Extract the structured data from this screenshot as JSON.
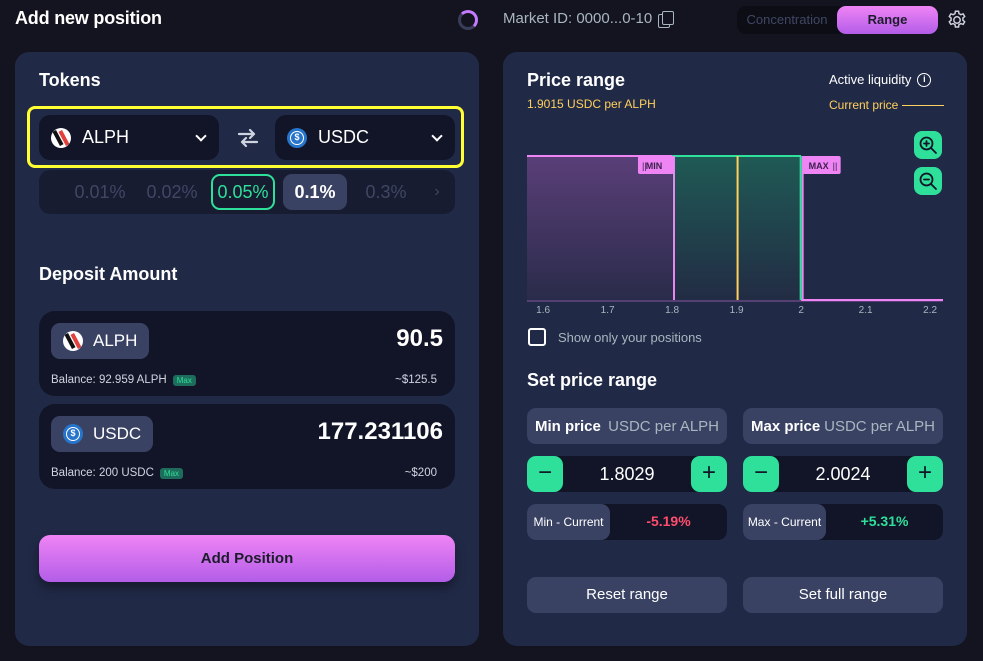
{
  "header": {
    "title": "Add new position",
    "market_id": "Market ID: 0000...0-10",
    "mode_concentration": "Concentration",
    "mode_range": "Range"
  },
  "tokens": {
    "title": "Tokens",
    "token_a": "ALPH",
    "token_b": "USDC",
    "fee_tiers": [
      "0.01%",
      "0.02%",
      "0.05%",
      "0.1%",
      "0.3%"
    ]
  },
  "deposit": {
    "title": "Deposit Amount",
    "a": {
      "token": "ALPH",
      "amount": "90.5",
      "balance": "Balance: 92.959 ALPH",
      "max": "Max",
      "usd": "~$125.5"
    },
    "b": {
      "token": "USDC",
      "amount": "177.231106",
      "balance": "Balance: 200 USDC",
      "max": "Max",
      "usd": "~$200"
    }
  },
  "add_position_label": "Add Position",
  "price_range": {
    "title": "Price range",
    "current_price_text": "1.9015 USDC per ALPH",
    "active_liquidity": "Active liquidity",
    "current_price_legend": "Current price",
    "show_only_yours": "Show only your positions"
  },
  "set_range": {
    "title": "Set price range",
    "min_label": "Min price",
    "max_label": "Max price",
    "unit": "USDC per ALPH",
    "min_value": "1.8029",
    "max_value": "2.0024",
    "min_current_label": "Min - Current",
    "min_current_value": "-5.19%",
    "max_current_label": "Max - Current",
    "max_current_value": "+5.31%",
    "reset": "Reset range",
    "full": "Set full range"
  },
  "chart_data": {
    "type": "area",
    "x_ticks": [
      "1.6",
      "1.7",
      "1.8",
      "1.9",
      "2",
      "2.1",
      "2.2"
    ],
    "xlim": [
      1.575,
      2.22
    ],
    "current_price": 1.9015,
    "min_price": 1.8029,
    "max_price": 2.0024,
    "min_label": "MIN",
    "max_label": "MAX",
    "liquidity_segments": [
      {
        "from": 1.575,
        "to": 1.8,
        "level": 1
      },
      {
        "from": 1.8,
        "to": 2.0,
        "level": 1
      },
      {
        "from": 2.0,
        "to": 2.22,
        "level": 0
      }
    ]
  },
  "colors": {
    "accent_green": "#2ee09a",
    "accent_pink": "#ef84f5",
    "current_price": "#ffd05c",
    "negative": "#ff4d6d"
  }
}
